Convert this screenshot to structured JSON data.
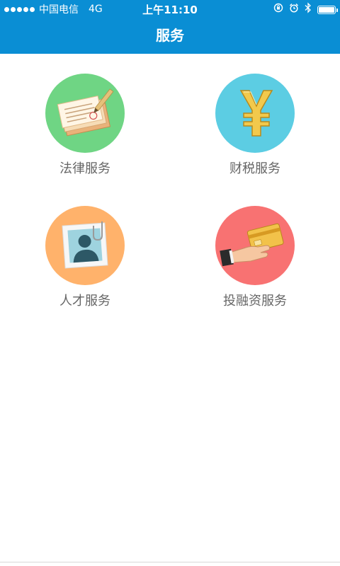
{
  "status_bar": {
    "carrier": "中国电信",
    "network": "4G",
    "time": "上午11:10"
  },
  "navbar": {
    "title": "服务"
  },
  "services": [
    {
      "label": "法律服务",
      "icon": "legal-documents-icon",
      "color": "#6fd584"
    },
    {
      "label": "财税服务",
      "icon": "yen-icon",
      "color": "#5ccde3"
    },
    {
      "label": "人才服务",
      "icon": "person-photo-icon",
      "color": "#ffb26b"
    },
    {
      "label": "投融资服务",
      "icon": "hand-card-icon",
      "color": "#f87272"
    }
  ],
  "colors": {
    "accent": "#0a8ed4",
    "label_text": "#666666"
  }
}
